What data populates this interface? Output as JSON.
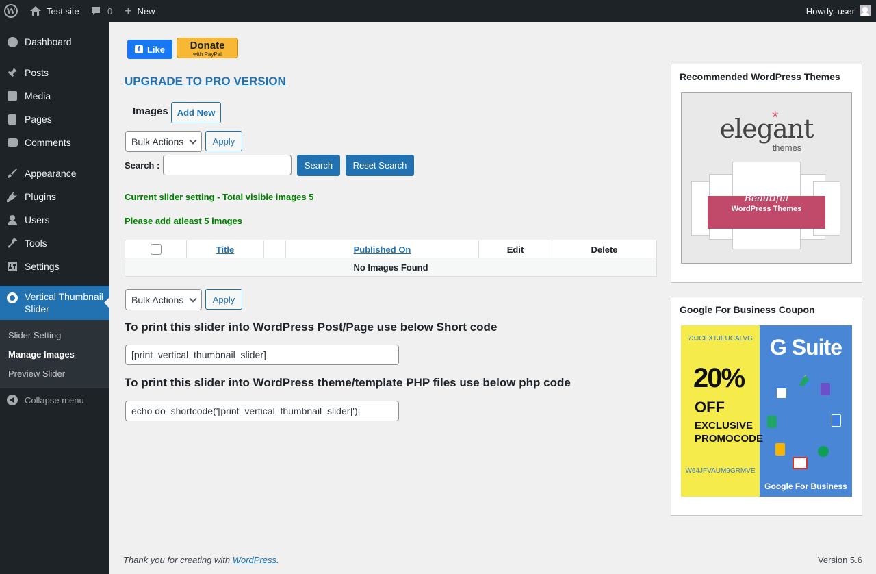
{
  "adminbar": {
    "site_name": "Test site",
    "comments_count": "0",
    "new_label": "New",
    "howdy": "Howdy, user"
  },
  "menu": {
    "items": [
      {
        "label": "Dashboard",
        "icon": "dashboard-icon"
      },
      {
        "label": "Posts",
        "icon": "pin-icon"
      },
      {
        "label": "Media",
        "icon": "media-icon"
      },
      {
        "label": "Pages",
        "icon": "pages-icon"
      },
      {
        "label": "Comments",
        "icon": "comment-icon"
      },
      {
        "label": "Appearance",
        "icon": "brush-icon"
      },
      {
        "label": "Plugins",
        "icon": "plug-icon"
      },
      {
        "label": "Users",
        "icon": "user-icon"
      },
      {
        "label": "Tools",
        "icon": "wrench-icon"
      },
      {
        "label": "Settings",
        "icon": "settings-icon"
      }
    ],
    "current": {
      "label": "Vertical Thumbnail Slider",
      "icon": "gear-icon"
    },
    "submenu": [
      "Slider Setting",
      "Manage Images",
      "Preview Slider"
    ],
    "collapse": "Collapse menu"
  },
  "main": {
    "fb_like": "Like",
    "donate": {
      "line1": "Donate",
      "line2": "with PayPal"
    },
    "upgrade": "UPGRADE TO PRO VERSION",
    "images_title": "Images",
    "add_new": "Add New",
    "bulk_actions": "Bulk Actions",
    "apply": "Apply",
    "search_label": "Search :",
    "search_value": "",
    "search_button": "Search",
    "reset_button": "Reset Search",
    "notice1": "Current slider setting - Total visible images 5",
    "notice2": "Please add atleast 5 images",
    "table": {
      "headers": [
        "Title",
        "",
        "Published On",
        "Edit",
        "Delete"
      ],
      "empty": "No Images Found"
    },
    "shortcode_heading": "To print this slider into WordPress Post/Page use below Short code",
    "shortcode_value": "[print_vertical_thumbnail_slider]",
    "php_heading": "To print this slider into WordPress theme/template PHP files use below php code",
    "php_value": "echo do_shortcode('[print_vertical_thumbnail_slider]');"
  },
  "widgets": {
    "themes_title": "Recommended WordPress Themes",
    "themes_banner": {
      "logo": "elegant",
      "sub": "themes",
      "ribbon1": "Beautiful",
      "ribbon2": "WordPress Themes"
    },
    "coupon_title": "Google For Business Coupon",
    "coupon_banner": {
      "code_top": "73JCEXTJEUCALVG",
      "percent": "20%",
      "off": "OFF",
      "exclusive": "EXCLUSIVE",
      "promocode": "PROMOCODE",
      "code_bottom": "W64JFVAUM9GRMVE",
      "product": "G Suite",
      "footer": "Google For Business"
    }
  },
  "footer": {
    "thanks_prefix": "Thank you for creating with ",
    "wordpress": "WordPress",
    "suffix": ".",
    "version": "Version 5.6"
  }
}
